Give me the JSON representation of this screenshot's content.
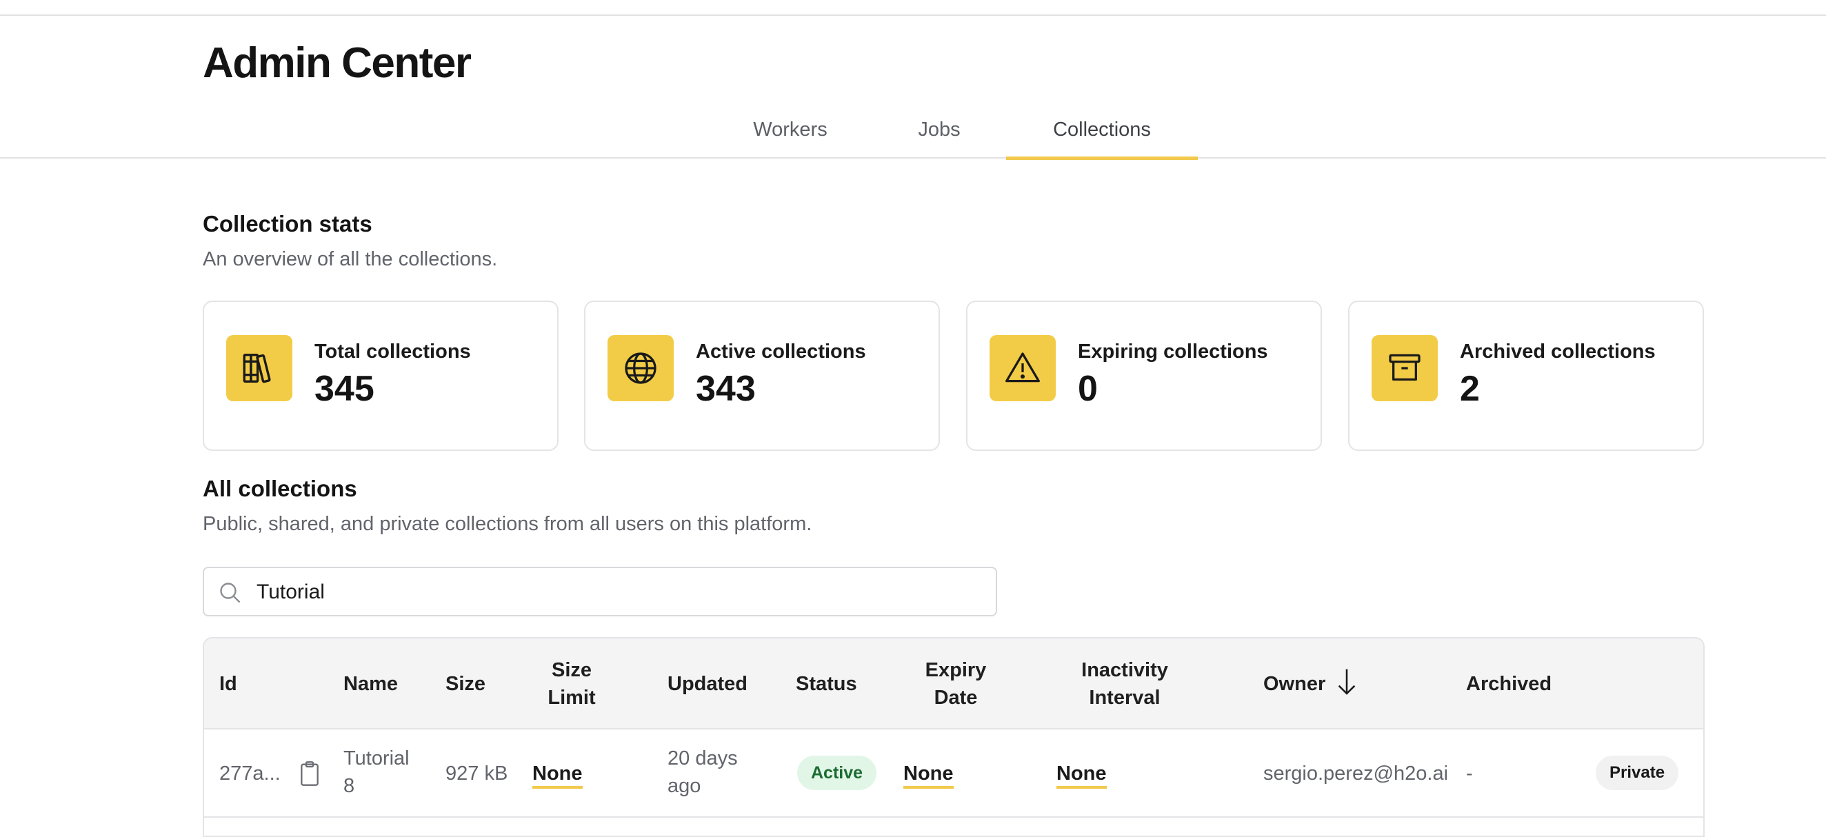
{
  "header": {
    "title": "Admin Center"
  },
  "tabs": [
    {
      "label": "Workers",
      "active": false
    },
    {
      "label": "Jobs",
      "active": false
    },
    {
      "label": "Collections",
      "active": true
    }
  ],
  "stats": {
    "title": "Collection stats",
    "subtitle": "An overview of all the collections.",
    "cards": [
      {
        "icon": "books-icon",
        "label": "Total collections",
        "value": "345"
      },
      {
        "icon": "globe-icon",
        "label": "Active collections",
        "value": "343"
      },
      {
        "icon": "warning-icon",
        "label": "Expiring collections",
        "value": "0"
      },
      {
        "icon": "archive-icon",
        "label": "Archived collections",
        "value": "2"
      }
    ]
  },
  "collections": {
    "title": "All collections",
    "subtitle": "Public, shared, and private collections from all users on this platform.",
    "search": {
      "value": "Tutorial"
    },
    "columns": {
      "id": "Id",
      "name": "Name",
      "size": "Size",
      "size_limit_1": "Size",
      "size_limit_2": "Limit",
      "updated": "Updated",
      "status": "Status",
      "expiry_1": "Expiry",
      "expiry_2": "Date",
      "inactivity_1": "Inactivity",
      "inactivity_2": "Interval",
      "owner": "Owner",
      "archived": "Archived"
    },
    "rows": [
      {
        "id": "277a...",
        "name_1": "Tutorial",
        "name_2": "8",
        "size": "927 kB",
        "size_limit": "None",
        "updated_1": "20 days",
        "updated_2": "ago",
        "status": "Active",
        "expiry": "None",
        "inactivity": "None",
        "owner": "sergio.perez@h2o.ai",
        "archived": "-",
        "visibility": "Private"
      }
    ]
  },
  "colors": {
    "accent": "#f2cc47",
    "active_badge_bg": "#e2f6e7",
    "active_badge_text": "#1c6b32"
  }
}
